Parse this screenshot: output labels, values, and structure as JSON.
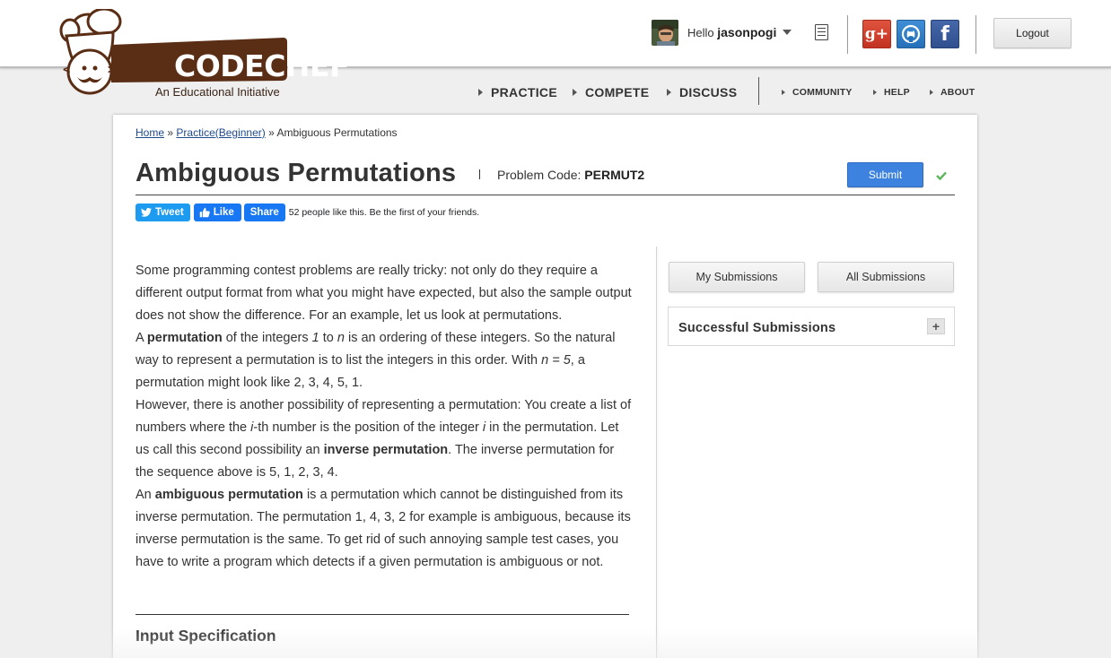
{
  "header": {
    "logo_text": "CODECHEF",
    "logo_subtitle": "An Educational Initiative",
    "greeting": "Hello",
    "username": "jasonpogi",
    "logout_label": "Logout",
    "social": {
      "google_plus_label": "g+",
      "facebook_label": "f"
    }
  },
  "nav": {
    "main": [
      {
        "label": "PRACTICE"
      },
      {
        "label": "COMPETE"
      },
      {
        "label": "DISCUSS"
      }
    ],
    "secondary": [
      {
        "label": "COMMUNITY"
      },
      {
        "label": "HELP"
      },
      {
        "label": "ABOUT"
      }
    ]
  },
  "breadcrumb": {
    "home": "Home",
    "sep1": "»",
    "practice": "Practice(Beginner)",
    "sep2": "»",
    "current": "Ambiguous Permutations"
  },
  "problem": {
    "title": "Ambiguous Permutations",
    "code_label": "Problem Code:",
    "code": "PERMUT2",
    "submit_label": "Submit"
  },
  "share": {
    "tweet_label": "Tweet",
    "like_label": "Like",
    "share_label": "Share",
    "likes_text": "52 people like this. Be the first of your friends."
  },
  "statement": {
    "p1": "Some programming contest problems are really tricky: not only do they require a different output format from what you might have expected, but also the sample output does not show the difference. For an example, let us look at permutations.",
    "p2_a": "A ",
    "p2_bold": "permutation",
    "p2_b": " of the integers ",
    "p2_i1": "1",
    "p2_c": " to ",
    "p2_i2": "n",
    "p2_d": " is an ordering of these integers. So the natural way to represent a permutation is to list the integers in this order. With ",
    "p2_i3": "n = 5",
    "p2_e": ", a permutation might look like 2, 3, 4, 5, 1.",
    "p3_a": "However, there is another possibility of representing a permutation: You create a list of numbers where the ",
    "p3_i1": "i",
    "p3_b": "-th number is the position of the integer ",
    "p3_i2": "i",
    "p3_c": " in the permutation. Let us call this second possibility an ",
    "p3_bold": "inverse permutation",
    "p3_d": ". The inverse permutation for the sequence above is 5, 1, 2, 3, 4.",
    "p4_a": "An ",
    "p4_bold": "ambiguous permutation",
    "p4_b": " is a permutation which cannot be distinguished from its inverse permutation. The permutation 1, 4, 3, 2 for example is ambiguous, because its inverse permutation is the same. To get rid of such annoying sample test cases, you have to write a program which detects if a given permutation is ambiguous or not.",
    "input_heading": "Input Specification"
  },
  "sidebar": {
    "my_submissions": "My Submissions",
    "all_submissions": "All Submissions",
    "successful_submissions": "Successful Submissions",
    "expand_label": "+"
  },
  "colors": {
    "submit_blue": "#3d82de",
    "logo_brown": "#5a2d15",
    "check_green": "#5cb85c"
  }
}
